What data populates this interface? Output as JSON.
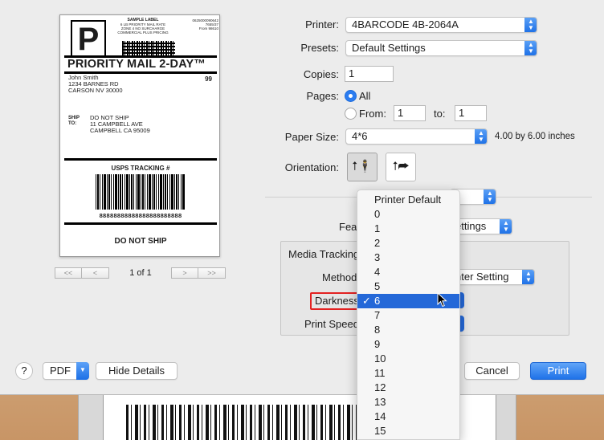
{
  "preview": {
    "sample_lines": [
      "SAMPLE LABEL",
      "6 LB PRIORITY MAIL RATE",
      "ZONE 4 NO SURCHARGE",
      "COMMERCIAL PLUS PRICING"
    ],
    "big_letter": "P",
    "code_lines": [
      "0625000090642",
      "7655/37",
      "From 98610"
    ],
    "title": "PRIORITY MAIL 2-DAY™",
    "from_lines": [
      "John Smith",
      "1234 BARNES RD",
      "CARSON NV 30000"
    ],
    "zone_number": "99",
    "ship_to_label": [
      "SHIP",
      "TO:"
    ],
    "to_lines": [
      "DO NOT SHIP",
      "11 CAMPBELL AVE",
      "CAMPBELL CA 95009"
    ],
    "tracking_heading": "USPS TRACKING #",
    "tracking_digits": "88888888888888888888888",
    "footer": "DO NOT SHIP"
  },
  "pager": {
    "first": "<<",
    "prev": "<",
    "next": ">",
    "last": ">>",
    "count": "1 of 1"
  },
  "form": {
    "printer_label": "Printer:",
    "printer_value": "4BARCODE 4B-2064A",
    "presets_label": "Presets:",
    "presets_value": "Default Settings",
    "copies_label": "Copies:",
    "copies_value": "1",
    "pages_label": "Pages:",
    "pages_all": "All",
    "pages_from": "From:",
    "from_value": "1",
    "to_label": "to:",
    "to_value": "1",
    "paper_label": "Paper Size:",
    "paper_value": "4*6",
    "paper_dims": "4.00 by 6.00 inches",
    "orientation_label": "Orientation:",
    "features_label_partial": "Fea",
    "features_value_partial": "ettings",
    "media_tracking_label": "Media Tracking",
    "method_label": "Method",
    "method_value_partial": "nter Setting",
    "darkness_label": "Darkness",
    "print_speed_label": "Print Speed"
  },
  "menu": {
    "items": [
      "Printer Default",
      "0",
      "1",
      "2",
      "3",
      "4",
      "5",
      "6",
      "7",
      "8",
      "9",
      "10",
      "11",
      "12",
      "13",
      "14",
      "15"
    ],
    "selected": "6",
    "checkmark": "✓"
  },
  "footer": {
    "help": "?",
    "pdf": "PDF",
    "hide_details": "Hide Details",
    "cancel": "Cancel",
    "print": "Print"
  },
  "colors": {
    "accent": "#1f72e8",
    "highlight": "#2468d8",
    "callout": "#e32222"
  }
}
